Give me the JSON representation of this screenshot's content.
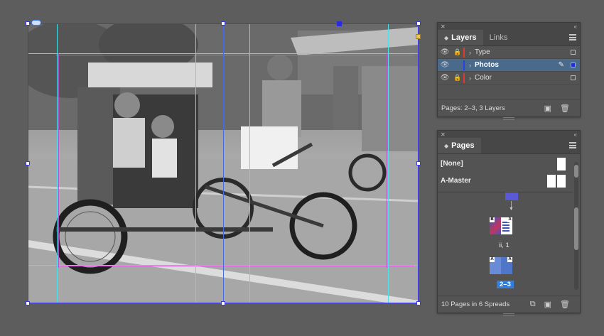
{
  "layers_panel": {
    "tabs": [
      {
        "label": "Layers",
        "active": true
      },
      {
        "label": "Links",
        "active": false
      }
    ],
    "layers": [
      {
        "name": "Type",
        "color": "#e03a2e",
        "locked": true,
        "selected": false
      },
      {
        "name": "Photos",
        "color": "#2d3fe8",
        "locked": false,
        "selected": true
      },
      {
        "name": "Color",
        "color": "#e03a2e",
        "locked": true,
        "selected": false
      }
    ],
    "footer": "Pages: 2–3, 3 Layers"
  },
  "pages_panel": {
    "tab": "Pages",
    "masters": [
      "[None]",
      "A-Master"
    ],
    "spreads": [
      {
        "label": "ii, 1",
        "left_letter": "B",
        "right_letter": "A",
        "selected": false
      },
      {
        "label": "2–3",
        "left_letter": "A",
        "right_letter": "A",
        "selected": true
      }
    ],
    "footer": "10 Pages in 6 Spreads"
  },
  "colors": {
    "selection": "#3b3bd8",
    "panel_bg": "#535353",
    "accent": "#2f7fe0"
  }
}
